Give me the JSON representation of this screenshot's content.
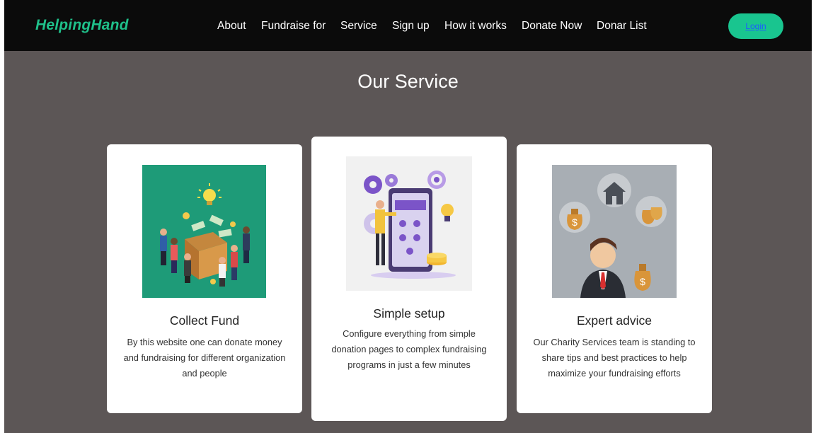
{
  "brand": "HelpingHand",
  "nav": {
    "items": [
      "About",
      "Fundraise for",
      "Service",
      "Sign up",
      "How it works",
      "Donate Now",
      "Donar List"
    ],
    "login_label": "Login"
  },
  "section_title": "Our Service",
  "cards": [
    {
      "title": "Collect Fund",
      "description": "By this website one can donate money and fundraising for different organization and people"
    },
    {
      "title": "Simple setup",
      "description": "Configure everything from simple donation pages to complex fundraising programs in just a few minutes"
    },
    {
      "title": "Expert advice",
      "description": "Our Charity Services team is standing to share tips and best practices to help maximize your fundraising efforts"
    }
  ],
  "colors": {
    "brand": "#1fc08a",
    "nav_bg": "#0b0b0b",
    "page_bg": "#5c5656",
    "login_bg": "#19c58f",
    "login_text": "#1e5bff"
  }
}
